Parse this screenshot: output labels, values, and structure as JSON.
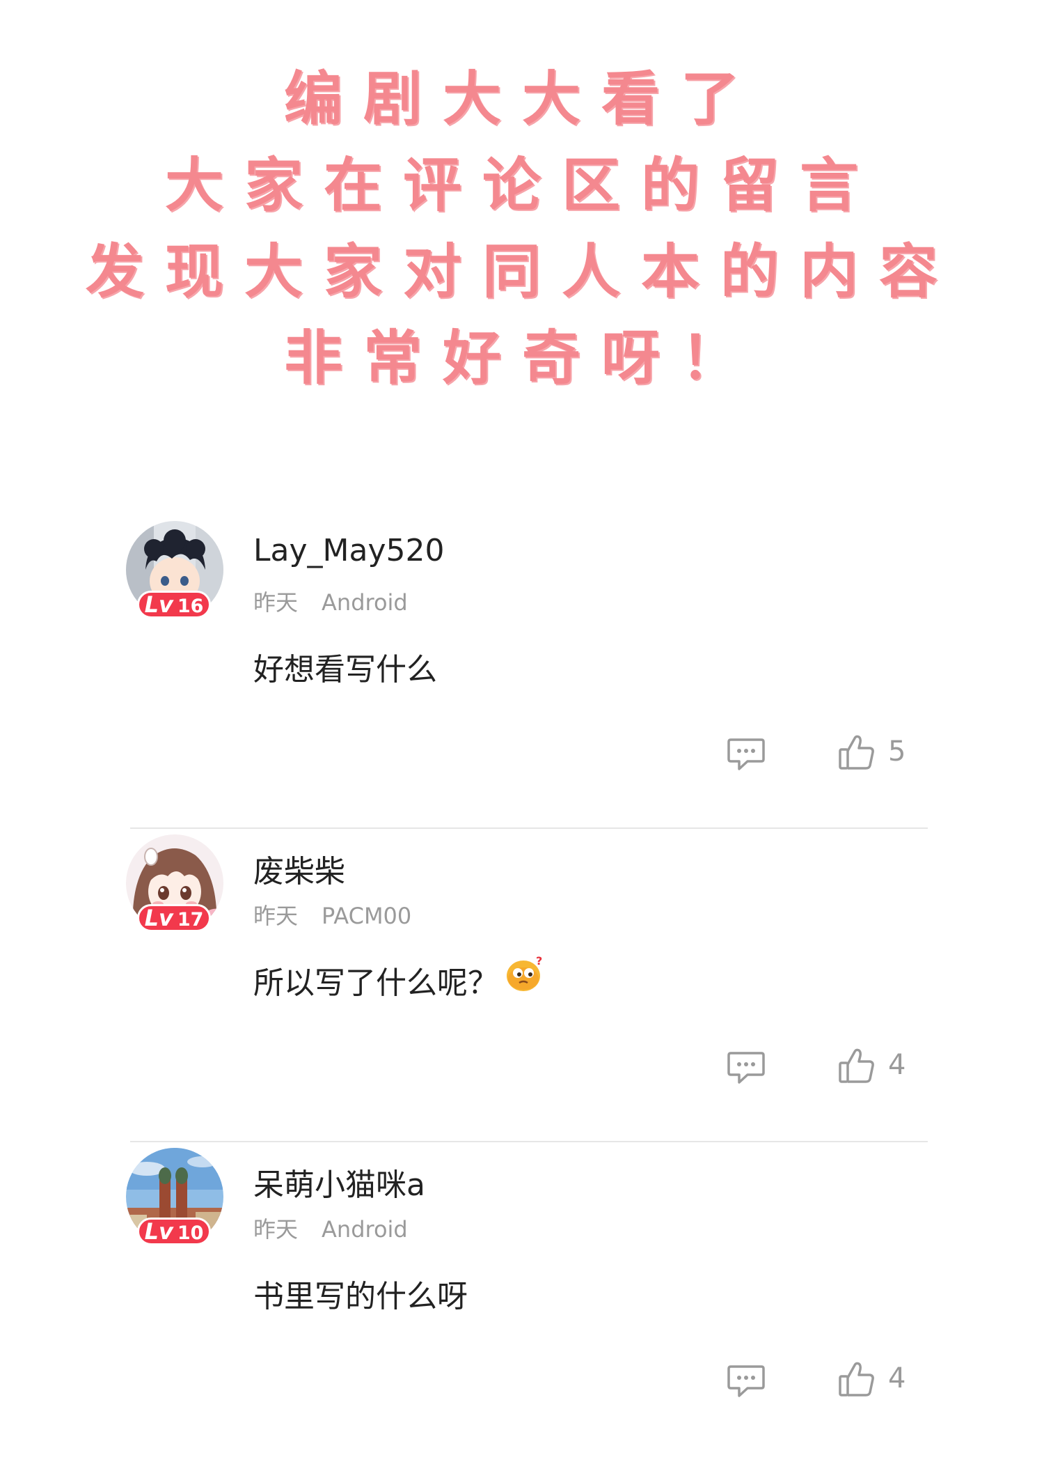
{
  "banner": {
    "lines": [
      "编剧大大看了",
      "大家在评论区的留言",
      "发现大家对同人本的内容",
      "非常好奇呀！"
    ]
  },
  "colors": {
    "banner_text": "#f4888f",
    "level_badge": "#f2394c",
    "username": "#222222",
    "meta": "#9a9a9a",
    "divider": "#e6e6e6"
  },
  "comments": [
    {
      "username": "Lay_May520",
      "level_prefix": "Lv",
      "level": "16",
      "time": "昨天",
      "device": "Android",
      "content": "好想看写什么",
      "avatar_icon": "chibi-boy-avatar",
      "reply_icon": "comment-bubble-icon",
      "like_icon": "thumbs-up-icon",
      "likes": "5"
    },
    {
      "username": "废柴柴",
      "level_prefix": "Lv",
      "level": "17",
      "time": "昨天",
      "device": "PACM00",
      "content": "所以写了什么呢？",
      "content_emoji": "confused-face-emoji",
      "avatar_icon": "anime-girl-avatar",
      "reply_icon": "comment-bubble-icon",
      "like_icon": "thumbs-up-icon",
      "likes": "4"
    },
    {
      "username": "呆萌小猫咪a",
      "level_prefix": "Lv",
      "level": "10",
      "time": "昨天",
      "device": "Android",
      "content": "书里写的什么呀",
      "avatar_icon": "city-cathedral-avatar",
      "reply_icon": "comment-bubble-icon",
      "like_icon": "thumbs-up-icon",
      "likes": "4"
    }
  ]
}
